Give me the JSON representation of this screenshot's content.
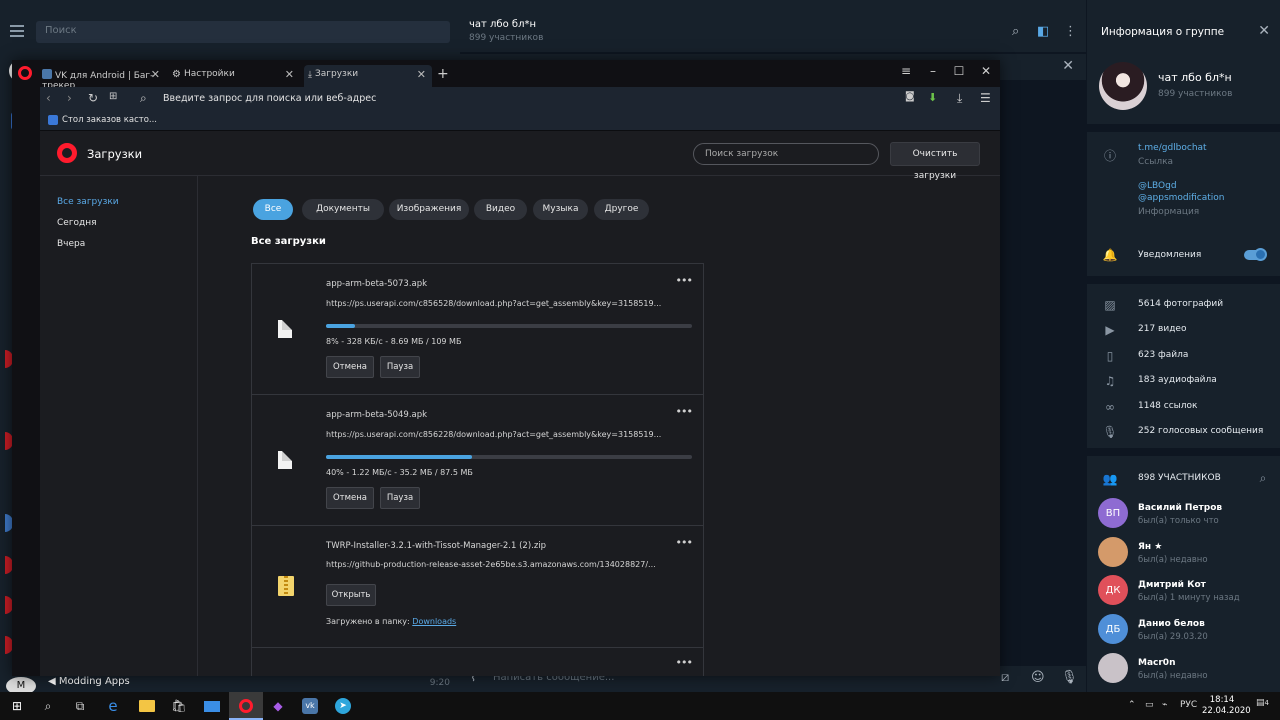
{
  "telegram": {
    "search_placeholder": "Поиск",
    "bottom_chat_title": "Modding Apps",
    "bottom_chat_time": "9:20",
    "chat_title": "чат лбо бл*н",
    "chat_subtitle": "899 участников",
    "compose_placeholder": "Написать сообщение...",
    "info": {
      "title": "Информация о группе",
      "group_name": "чат лбо бл*н",
      "members": "899 участников",
      "link": "t.me/gdlbochat",
      "link_caption": "Ссылка",
      "info_line1": "@LBOgd",
      "info_line2": "@appsmodification",
      "info_caption": "Информация",
      "notifications_label": "Уведомления",
      "notifications_on": true,
      "media": [
        {
          "icon": "photo-icon",
          "label": "5614 фотографий"
        },
        {
          "icon": "video-icon",
          "label": "217 видео"
        },
        {
          "icon": "file-icon",
          "label": "623 файла"
        },
        {
          "icon": "headphones-icon",
          "label": "183 аудиофайла"
        },
        {
          "icon": "link-icon",
          "label": "1148 ссылок"
        },
        {
          "icon": "microphone-icon",
          "label": "252 голосовых сообщения"
        }
      ],
      "members_header": "898 УЧАСТНИКОВ",
      "member_list": [
        {
          "initials": "ВП",
          "name": "Василий Петров",
          "status": "был(а) только что",
          "color": "#8e6bd2"
        },
        {
          "initials": "",
          "name": "Ян ★",
          "status": "был(а) недавно",
          "color": "#d49a6a"
        },
        {
          "initials": "ДК",
          "name": "Дмитрий Кот",
          "status": "был(а) 1 минуту назад",
          "color": "#e0505a"
        },
        {
          "initials": "ДБ",
          "name": "Данио белов",
          "status": "был(а) 29.03.20",
          "color": "#4f8fd8"
        },
        {
          "initials": "",
          "name": "Macr0n",
          "status": "был(а) недавно",
          "color": "#c9c2c8"
        }
      ]
    }
  },
  "opera": {
    "tabs": [
      {
        "label": "VK для Android | Баг-трекер",
        "favicon_color": "#4a76a8"
      },
      {
        "label": "Настройки",
        "favicon_color": "#888888"
      },
      {
        "label": "Загрузки",
        "favicon_color": "#3a78d8"
      }
    ],
    "address_placeholder": "Введите запрос для поиска или веб-адрес",
    "bookmark": "Стол заказов касто...",
    "downloads": {
      "title": "Загрузки",
      "search_placeholder": "Поиск загрузок",
      "clear_button": "Очистить загрузки",
      "nav": [
        "Все загрузки",
        "Сегодня",
        "Вчера"
      ],
      "filters": [
        "Все",
        "Документы",
        "Изображения",
        "Видео",
        "Музыка",
        "Другое"
      ],
      "section_title": "Все загрузки",
      "items": [
        {
          "filename": "app-arm-beta-5073.apk",
          "url": "https://ps.userapi.com/c856528/download.php?act=get_assembly&key=3158519...",
          "progress": 0.08,
          "status": "8% - 328 КБ/с - 8.69 МБ / 109 МБ",
          "cancel": "Отмена",
          "pause": "Пауза"
        },
        {
          "filename": "app-arm-beta-5049.apk",
          "url": "https://ps.userapi.com/c856228/download.php?act=get_assembly&key=3158519...",
          "progress": 0.4,
          "status": "40% - 1.22 МБ/с - 35.2 МБ / 87.5 МБ",
          "cancel": "Отмена",
          "pause": "Пауза"
        },
        {
          "filename": "TWRP-Installer-3.2.1-with-Tissot-Manager-2.1 (2).zip",
          "url": "https://github-production-release-asset-2e65be.s3.amazonaws.com/134028827/...",
          "open": "Открыть",
          "saved_prefix": "Загружено в папку:",
          "saved_folder": "Downloads"
        }
      ]
    }
  },
  "taskbar": {
    "language": "РУС",
    "time": "18:14",
    "date": "22.04.2020",
    "notifications": "4"
  }
}
